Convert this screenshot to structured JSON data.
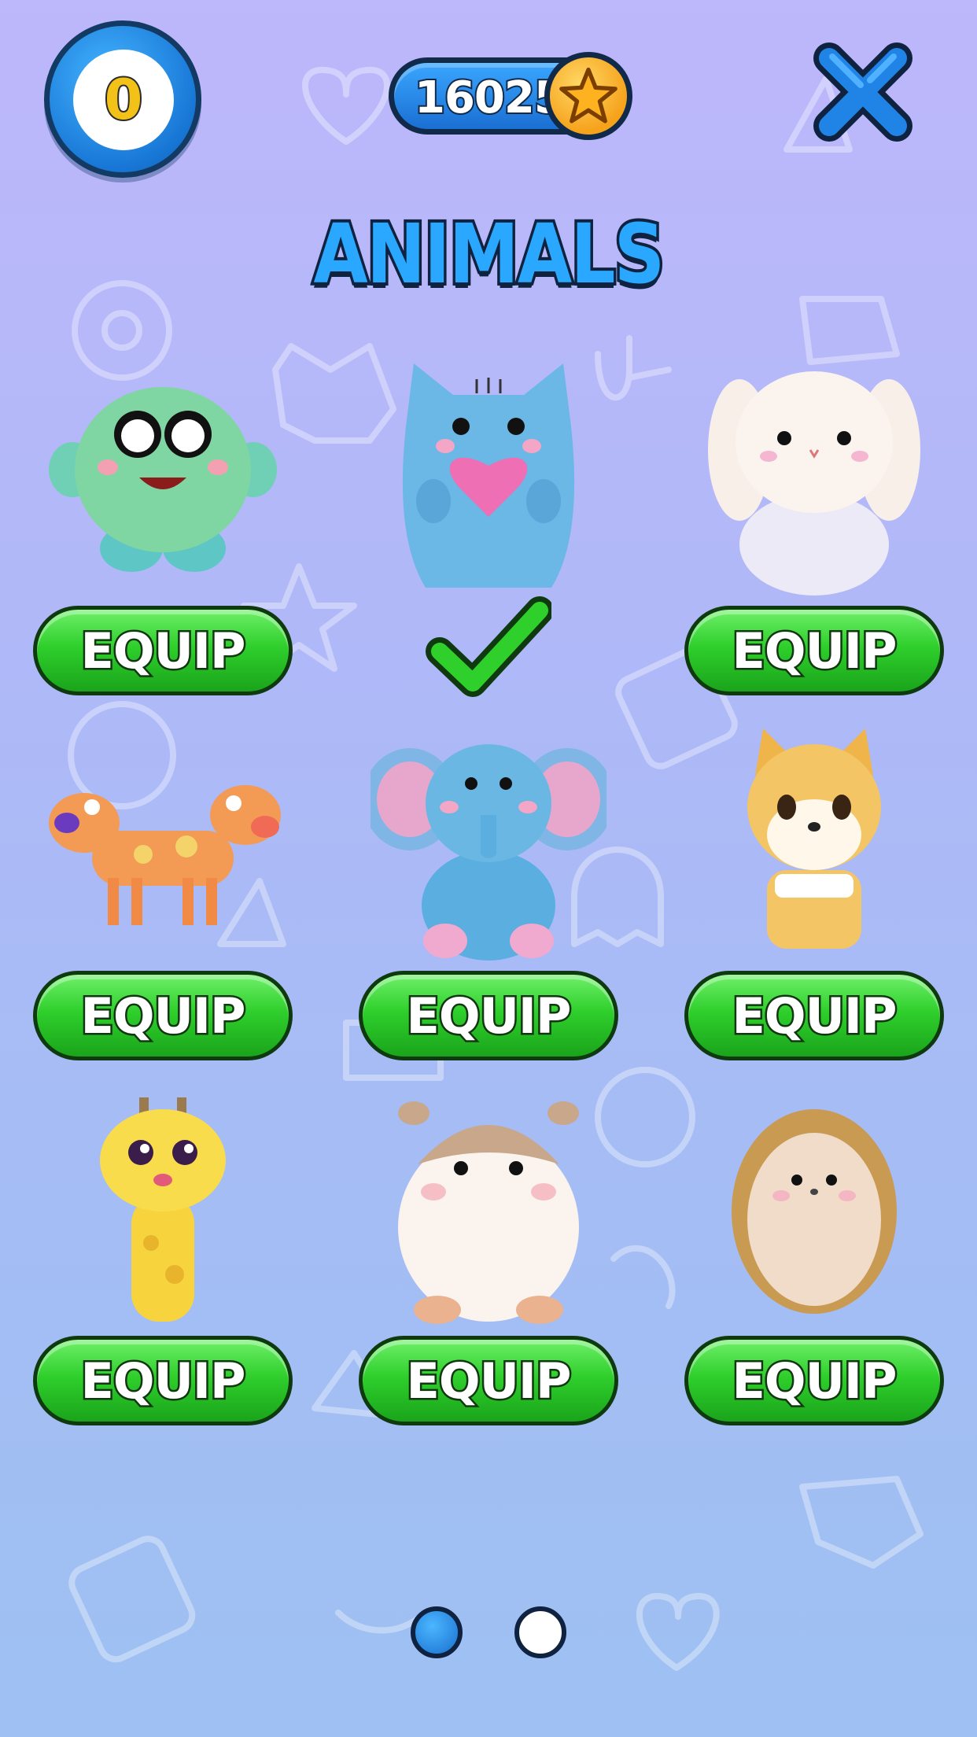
{
  "header": {
    "level_value": "0",
    "coin_amount": "16025",
    "close_icon": "close-x-icon",
    "coin_icon": "star-coin-icon"
  },
  "title": "ANIMALS",
  "items": [
    {
      "name": "green-blob",
      "button_label": "EQUIP",
      "equipped": false
    },
    {
      "name": "blue-cat",
      "button_label": "",
      "equipped": true
    },
    {
      "name": "white-bunny",
      "button_label": "EQUIP",
      "equipped": false
    },
    {
      "name": "orange-two-headed-dog",
      "button_label": "EQUIP",
      "equipped": false
    },
    {
      "name": "blue-elephant",
      "button_label": "EQUIP",
      "equipped": false
    },
    {
      "name": "shiba-dog",
      "button_label": "EQUIP",
      "equipped": false
    },
    {
      "name": "yellow-giraffe",
      "button_label": "EQUIP",
      "equipped": false
    },
    {
      "name": "hamster",
      "button_label": "EQUIP",
      "equipped": false
    },
    {
      "name": "hedgehog",
      "button_label": "EQUIP",
      "equipped": false
    }
  ],
  "pagination": {
    "current_page": 1,
    "total_pages": 2
  },
  "colors": {
    "accent_blue": "#2aa8ff",
    "equip_green": "#2fcf2c",
    "outline_dark": "#0f2340"
  }
}
